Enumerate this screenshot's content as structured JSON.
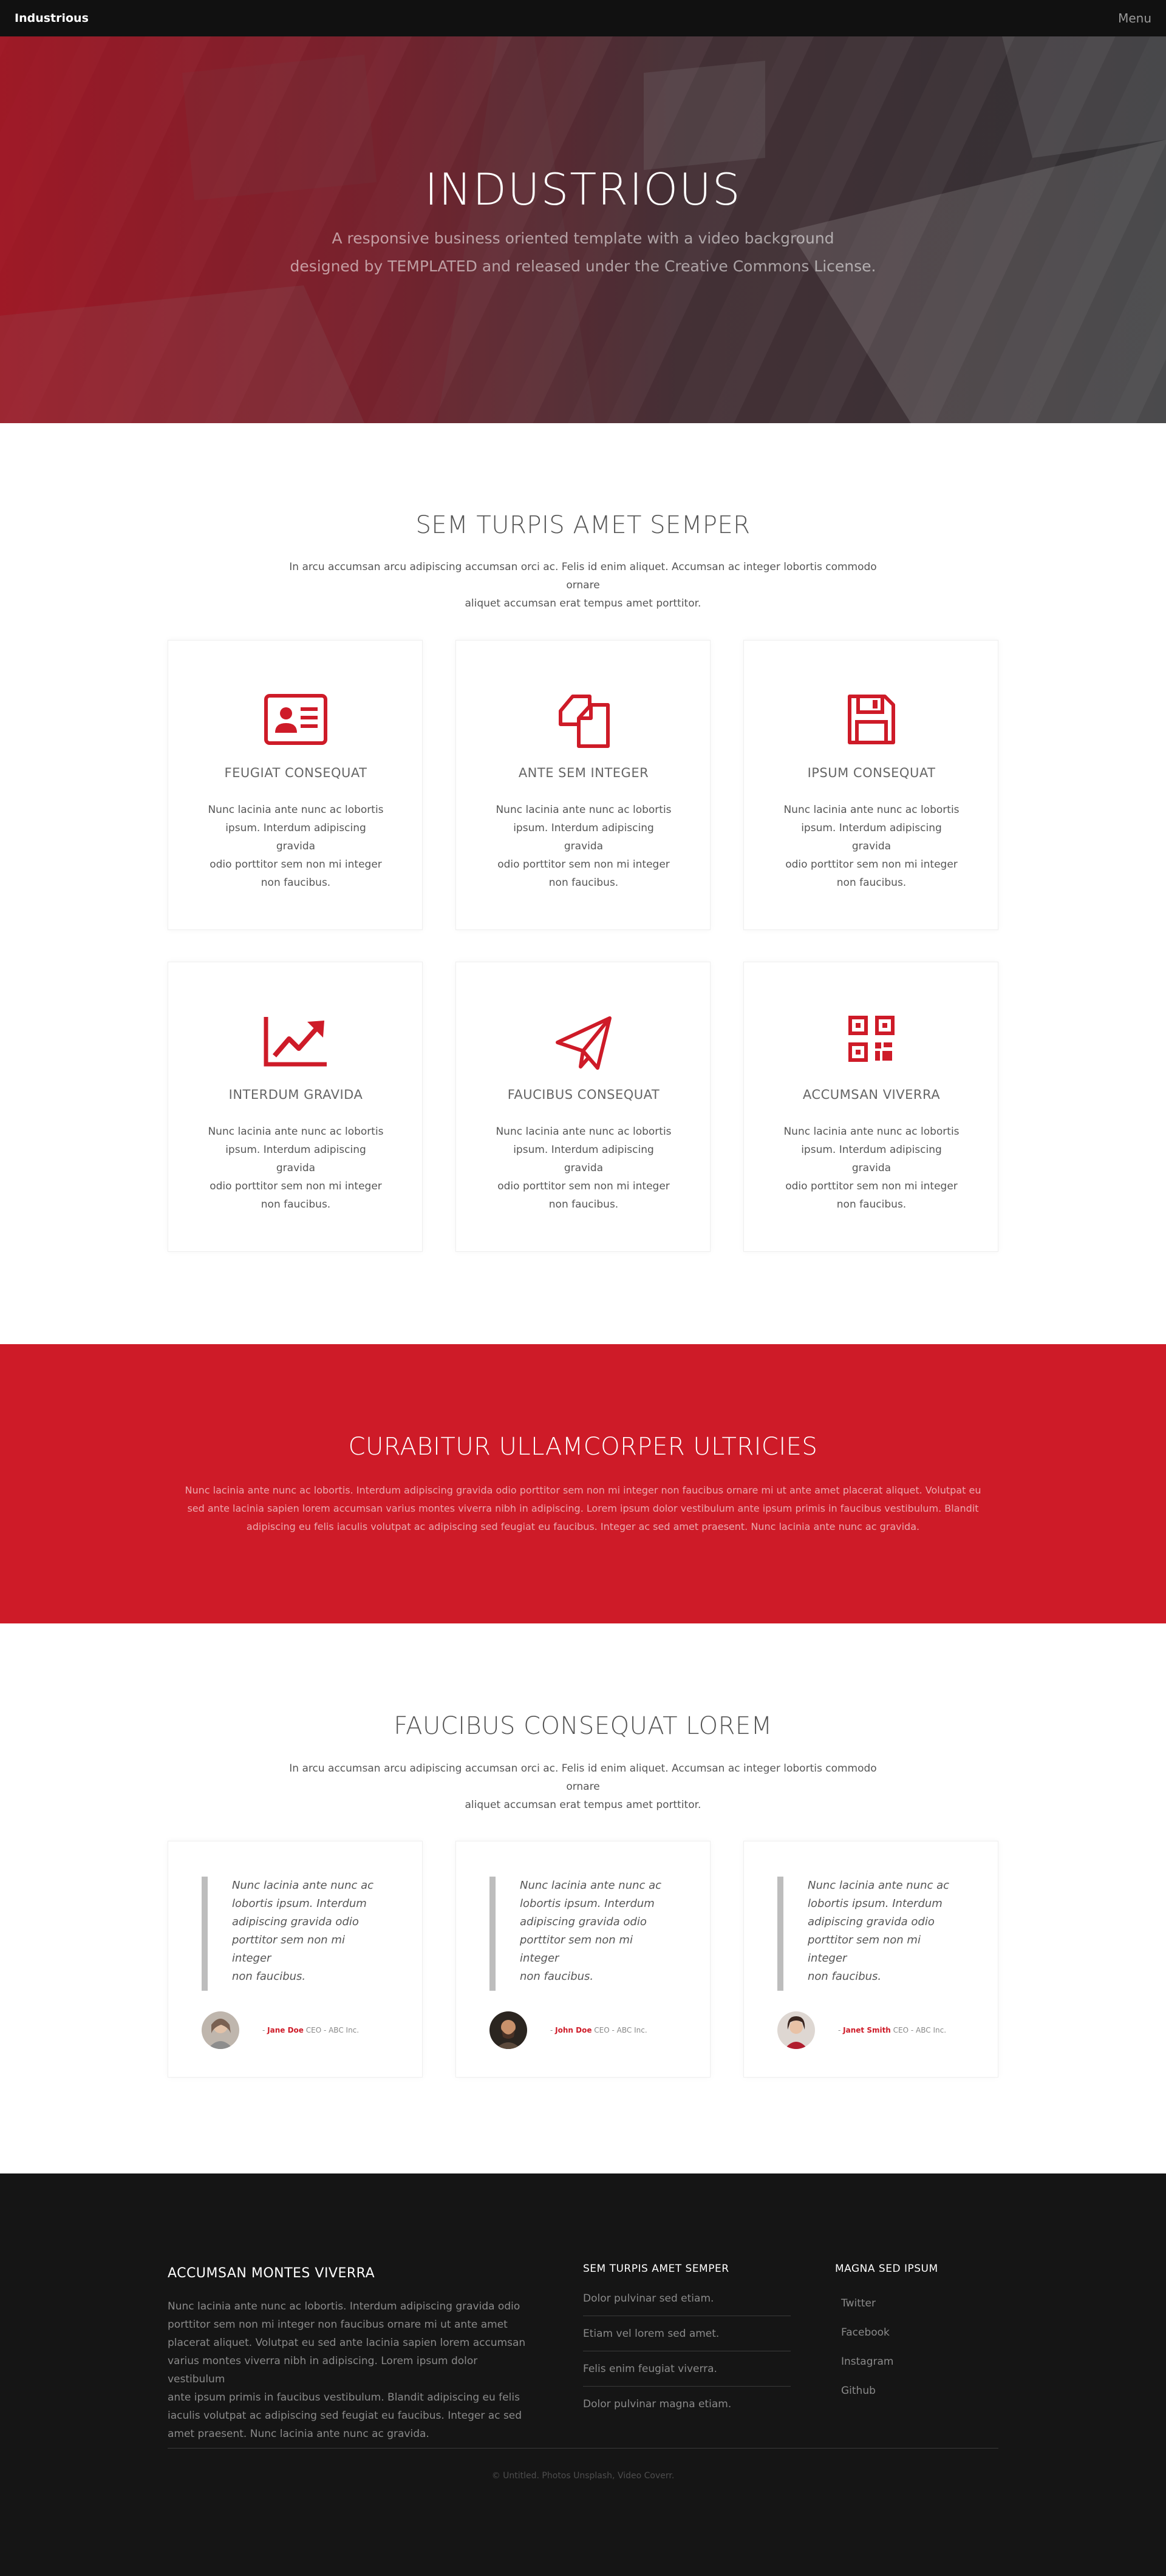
{
  "header": {
    "brand": "Industrious",
    "menu_label": "Menu"
  },
  "hero": {
    "title": "INDUSTRIOUS",
    "subtitle_line1": "A responsive business oriented template with a video background",
    "subtitle_line2": "designed by TEMPLATED and released under the Creative Commons License."
  },
  "intro": {
    "title": "SEM TURPIS AMET SEMPER",
    "desc_line1": "In arcu accumsan arcu adipiscing accumsan orci ac. Felis id enim aliquet. Accumsan ac integer lobortis commodo ornare",
    "desc_line2": "aliquet accumsan erat tempus amet porttitor.",
    "features": [
      {
        "title": "FEUGIAT CONSEQUAT",
        "icon": "id-card-icon",
        "l1": "Nunc lacinia ante nunc ac lobortis",
        "l2": "ipsum. Interdum adipiscing gravida",
        "l3": "odio porttitor sem non mi integer",
        "l4": "non faucibus."
      },
      {
        "title": "ANTE SEM INTEGER",
        "icon": "copy-documents-icon",
        "l1": "Nunc lacinia ante nunc ac lobortis",
        "l2": "ipsum. Interdum adipiscing gravida",
        "l3": "odio porttitor sem non mi integer",
        "l4": "non faucibus."
      },
      {
        "title": "IPSUM CONSEQUAT",
        "icon": "floppy-disk-icon",
        "l1": "Nunc lacinia ante nunc ac lobortis",
        "l2": "ipsum. Interdum adipiscing gravida",
        "l3": "odio porttitor sem non mi integer",
        "l4": "non faucibus."
      },
      {
        "title": "INTERDUM GRAVIDA",
        "icon": "chart-line-icon",
        "l1": "Nunc lacinia ante nunc ac lobortis",
        "l2": "ipsum. Interdum adipiscing gravida",
        "l3": "odio porttitor sem non mi integer",
        "l4": "non faucibus."
      },
      {
        "title": "FAUCIBUS CONSEQUAT",
        "icon": "paper-plane-icon",
        "l1": "Nunc lacinia ante nunc ac lobortis",
        "l2": "ipsum. Interdum adipiscing gravida",
        "l3": "odio porttitor sem non mi integer",
        "l4": "non faucibus."
      },
      {
        "title": "ACCUMSAN VIVERRA",
        "icon": "qrcode-icon",
        "l1": "Nunc lacinia ante nunc ac lobortis",
        "l2": "ipsum. Interdum adipiscing gravida",
        "l3": "odio porttitor sem non mi integer",
        "l4": "non faucibus."
      }
    ]
  },
  "cta": {
    "title": "CURABITUR ULLAMCORPER ULTRICIES",
    "l1": "Nunc lacinia ante nunc ac lobortis. Interdum adipiscing gravida odio porttitor sem non mi integer non faucibus ornare mi ut ante amet placerat aliquet. Volutpat eu",
    "l2": "sed ante lacinia sapien lorem accumsan varius montes viverra nibh in adipiscing. Lorem ipsum dolor vestibulum ante ipsum primis in faucibus vestibulum. Blandit",
    "l3": "adipiscing eu felis iaculis volutpat ac adipiscing sed feugiat eu faucibus. Integer ac sed amet praesent. Nunc lacinia ante nunc ac gravida."
  },
  "testimonials": {
    "title": "FAUCIBUS CONSEQUAT LOREM",
    "desc_line1": "In arcu accumsan arcu adipiscing accumsan orci ac. Felis id enim aliquet. Accumsan ac integer lobortis commodo ornare",
    "desc_line2": "aliquet accumsan erat tempus amet porttitor.",
    "items": [
      {
        "q1": "Nunc lacinia ante nunc ac",
        "q2": "lobortis ipsum. Interdum",
        "q3": "adipiscing gravida odio",
        "q4": "porttitor sem non mi integer",
        "q5": "non faucibus.",
        "dash": "- ",
        "name": "Jane Doe",
        "role": " CEO - ABC Inc."
      },
      {
        "q1": "Nunc lacinia ante nunc ac",
        "q2": "lobortis ipsum. Interdum",
        "q3": "adipiscing gravida odio",
        "q4": "porttitor sem non mi integer",
        "q5": "non faucibus.",
        "dash": "- ",
        "name": "John Doe",
        "role": " CEO - ABC Inc."
      },
      {
        "q1": "Nunc lacinia ante nunc ac",
        "q2": "lobortis ipsum. Interdum",
        "q3": "adipiscing gravida odio",
        "q4": "porttitor sem non mi integer",
        "q5": "non faucibus.",
        "dash": "- ",
        "name": "Janet Smith",
        "role": " CEO - ABC Inc."
      }
    ]
  },
  "footer": {
    "about_title": "ACCUMSAN MONTES VIVERRA",
    "about_l1": "Nunc lacinia ante nunc ac lobortis. Interdum adipiscing gravida odio",
    "about_l2": "porttitor sem non mi integer non faucibus ornare mi ut ante amet",
    "about_l3": "placerat aliquet. Volutpat eu sed ante lacinia sapien lorem accumsan",
    "about_l4": "varius montes viverra nibh in adipiscing. Lorem ipsum dolor vestibulum",
    "about_l5": "ante ipsum primis in faucibus vestibulum. Blandit adipiscing eu felis",
    "about_l6": "iaculis volutpat ac adipiscing sed feugiat eu faucibus. Integer ac sed",
    "about_l7": "amet praesent. Nunc lacinia ante nunc ac gravida.",
    "col2_title": "SEM TURPIS AMET SEMPER",
    "col2_links": [
      "Dolor pulvinar sed etiam.",
      "Etiam vel lorem sed amet.",
      "Felis enim feugiat viverra.",
      "Dolor pulvinar magna etiam."
    ],
    "col3_title": "MAGNA SED IPSUM",
    "col3_links": [
      "Twitter",
      "Facebook",
      "Instagram",
      "Github"
    ],
    "copyright": "© Untitled. Photos Unsplash, Video Coverr."
  },
  "colors": {
    "accent": "#ce1b28",
    "header_bg": "#111111",
    "footer_bg": "#151515"
  }
}
